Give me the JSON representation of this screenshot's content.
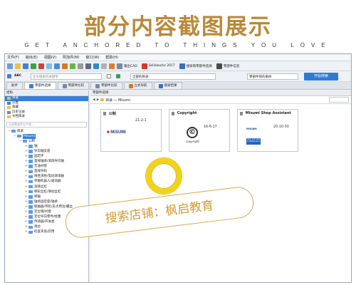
{
  "banner": {
    "title": "部分内容截图展示",
    "subtitle": "GET ANCHORED TO THINGS YOU LOVE"
  },
  "menubar": {
    "items": [
      "文件(F)",
      "输出(E)",
      "视图(V)",
      "附加件(M)",
      "窗口(W)",
      "帮助(H)"
    ]
  },
  "toolbar1": {
    "cad_label": "输出CAD",
    "solidworks_label": "Solidworks 2017",
    "search_parts_label": "搜索和零部件选择",
    "parts_label": "零部件信息"
  },
  "toolbar2": {
    "search_placeholder": "全文搜索的关键字",
    "filter_value": "全部的目录",
    "category_value": "零部件目的来体",
    "start_button": "开始搜索"
  },
  "tabs": [
    "助手",
    "零部件选择",
    "零部件比较",
    "零部件比较",
    "立式导航",
    "搜索结果"
  ],
  "sidebar": {
    "header": "结构",
    "items": [
      "目录",
      "分类",
      "收藏",
      "历史记录",
      "文档目录"
    ],
    "filter_placeholder": "过滤零部件生产商...",
    "tree": [
      {
        "label": "目录",
        "level": 0,
        "expanded": true
      },
      {
        "label": "Misumi",
        "level": 1,
        "expanded": true,
        "selected": true
      },
      {
        "label": "公制",
        "level": 2,
        "expanded": true
      },
      {
        "label": "轴",
        "level": 3
      },
      {
        "label": "导向轴支座",
        "level": 3
      },
      {
        "label": "固定环",
        "level": 3
      },
      {
        "label": "直线轴承/滚珠导向轴",
        "level": 3
      },
      {
        "label": "无油衬套",
        "level": 3
      },
      {
        "label": "直线导轨",
        "level": 3
      },
      {
        "label": "线性滚柱/电动滚珠轴",
        "level": 3
      },
      {
        "label": "单轴机器人/驱动器",
        "level": 3
      },
      {
        "label": "滚珠丝杠",
        "level": 3
      },
      {
        "label": "梯形丝杠/滑动丝杠",
        "level": 3
      },
      {
        "label": "转轴",
        "level": 3
      },
      {
        "label": "轴承固定座/轴承",
        "level": 3
      },
      {
        "label": "联轴器/带轮/支点用台/螺丝",
        "level": 3
      },
      {
        "label": "定位销/衬套",
        "level": 3
      },
      {
        "label": "定位导向零件/柱塞",
        "level": 3
      },
      {
        "label": "传感器/开关类",
        "level": 3
      },
      {
        "label": "滑台",
        "level": 3
      },
      {
        "label": "检查夹具/药用",
        "level": 3
      }
    ]
  },
  "main": {
    "header": "零部件选择",
    "breadcrumb": "目录 — Misumi",
    "cards": [
      {
        "title": "公制",
        "date": "21-2-1",
        "logo": "MiSUMi"
      },
      {
        "title": "Copyright",
        "date": "16-6-17",
        "logo": "copyright"
      },
      {
        "title": "Misumi Shop Assistant",
        "date": "20-10-30",
        "logo": "MiSUMi",
        "logo2": "Open CAD Shop in PARTsolutions"
      }
    ]
  },
  "watermark": "搜索店铺：枫启教育",
  "colors": {
    "banner_gold": "#b8893a",
    "accent_blue": "#2e7bd6",
    "ring_yellow": "#f2d21a",
    "watermark": "#d29a35"
  }
}
